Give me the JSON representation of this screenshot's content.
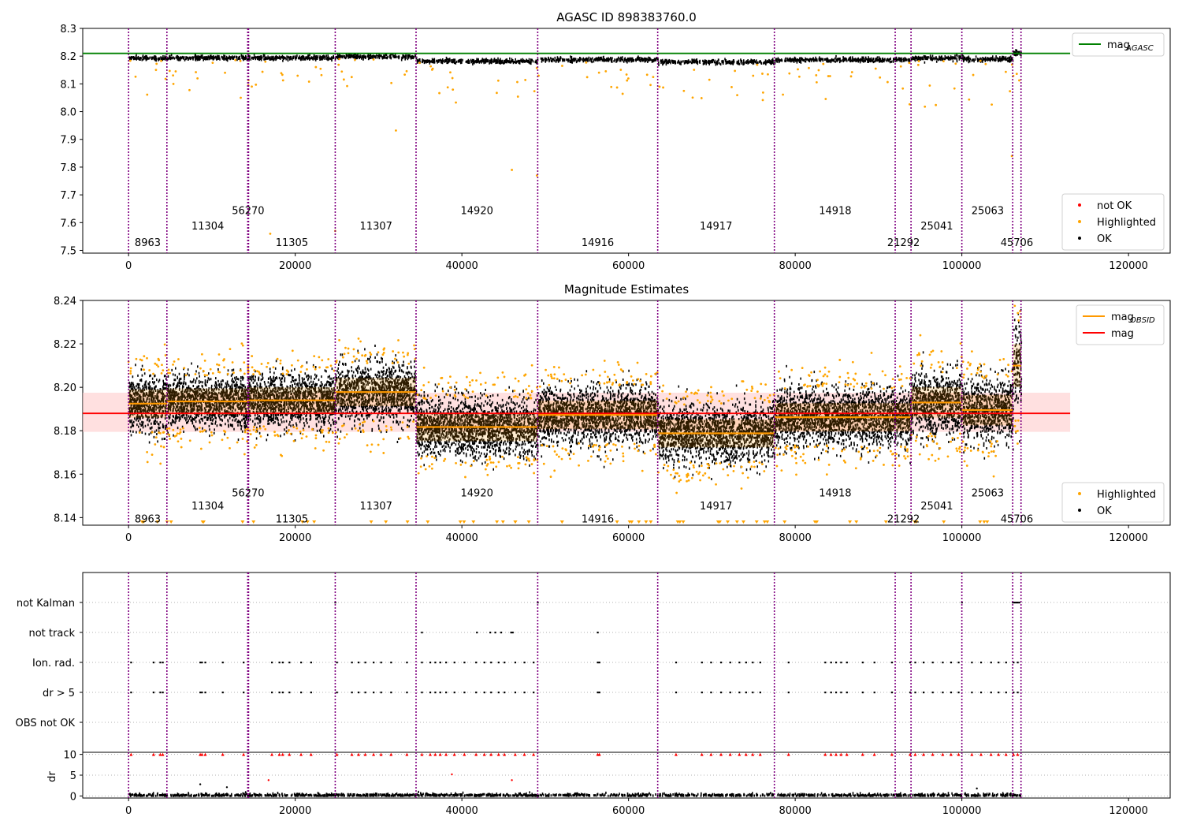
{
  "colors": {
    "ok": "#000000",
    "not_ok": "#ff0000",
    "highlighted": "#ffa500",
    "mag_agasc": "#008000",
    "mag": "#ff0000",
    "mag_band": "#ffcccc",
    "obsid_line": "#800080",
    "obsid_mag": "#ff9900",
    "grid": "#b0b0b0"
  },
  "chart_data": [
    {
      "type": "scatter",
      "title": "AGASC ID 898383760.0",
      "xlim": [
        -5500,
        125000
      ],
      "ylim": [
        7.49,
        8.3
      ],
      "xticks": [
        0,
        20000,
        40000,
        60000,
        80000,
        100000,
        120000
      ],
      "xtick_labels": [
        "0",
        "20000",
        "40000",
        "60000",
        "80000",
        "100000",
        "120000"
      ],
      "yticks": [
        7.5,
        7.6,
        7.7,
        7.8,
        7.9,
        8.0,
        8.1,
        8.2,
        8.3
      ],
      "ytick_labels": [
        "7.5",
        "7.6",
        "7.7",
        "7.8",
        "7.9",
        "8.0",
        "8.1",
        "8.2",
        "8.3"
      ],
      "mag_agasc": 8.21,
      "mag_agasc_x": [
        -5500,
        113000
      ],
      "legend_upper": {
        "position": "upper right",
        "entries": [
          {
            "label": "mag",
            "sub": "AGASC",
            "color": "#008000"
          }
        ]
      },
      "legend_lower": {
        "position": "lower right",
        "entries": [
          {
            "label": "not OK",
            "color": "#ff0000"
          },
          {
            "label": "Highlighted",
            "color": "#ffa500"
          },
          {
            "label": "OK",
            "color": "#000000"
          }
        ]
      },
      "obsid_boundaries": [
        0,
        4600,
        14300,
        14400,
        24800,
        34500,
        49100,
        63500,
        77500,
        92000,
        93900,
        100000,
        106100,
        107100
      ],
      "obsid_labels": [
        {
          "text": "8963",
          "x": 2300,
          "row": 0
        },
        {
          "text": "11304",
          "x": 9500,
          "row": 1
        },
        {
          "text": "56270",
          "x": 14350,
          "row": 2
        },
        {
          "text": "11305",
          "x": 19600,
          "row": 0
        },
        {
          "text": "11307",
          "x": 29700,
          "row": 1
        },
        {
          "text": "14920",
          "x": 41800,
          "row": 2
        },
        {
          "text": "14916",
          "x": 56300,
          "row": 0
        },
        {
          "text": "14917",
          "x": 70500,
          "row": 1
        },
        {
          "text": "14918",
          "x": 84800,
          "row": 2
        },
        {
          "text": "21292",
          "x": 93000,
          "row": 0
        },
        {
          "text": "25041",
          "x": 97000,
          "row": 1
        },
        {
          "text": "25063",
          "x": 103100,
          "row": 2
        },
        {
          "text": "45706",
          "x": 106600,
          "row": 0
        }
      ],
      "label_rows_y": [
        7.53,
        7.59,
        7.645
      ]
    },
    {
      "type": "scatter",
      "title": "Magnitude Estimates",
      "xlim": [
        -5500,
        125000
      ],
      "ylim": [
        8.1365,
        8.24
      ],
      "xticks": [
        0,
        20000,
        40000,
        60000,
        80000,
        100000,
        120000
      ],
      "xtick_labels": [
        "0",
        "20000",
        "40000",
        "60000",
        "80000",
        "100000",
        "120000"
      ],
      "yticks": [
        8.14,
        8.16,
        8.18,
        8.2,
        8.22,
        8.24
      ],
      "ytick_labels": [
        "8.14",
        "8.16",
        "8.18",
        "8.20",
        "8.22",
        "8.24"
      ],
      "mag": 8.188,
      "mag_band": [
        8.1795,
        8.1975
      ],
      "mag_x": [
        -5500,
        113000
      ],
      "obsid_segments": [
        {
          "x0": 0,
          "x1": 4600,
          "mean": 8.1925,
          "std": 0.0065
        },
        {
          "x0": 4600,
          "x1": 14300,
          "mean": 8.1935,
          "std": 0.006
        },
        {
          "x0": 14300,
          "x1": 14400,
          "mean": 8.194,
          "std": 0.006
        },
        {
          "x0": 14400,
          "x1": 24800,
          "mean": 8.194,
          "std": 0.006
        },
        {
          "x0": 24800,
          "x1": 34500,
          "mean": 8.1978,
          "std": 0.0065
        },
        {
          "x0": 34500,
          "x1": 49100,
          "mean": 8.1817,
          "std": 0.0065
        },
        {
          "x0": 49100,
          "x1": 63500,
          "mean": 8.1873,
          "std": 0.0065
        },
        {
          "x0": 63500,
          "x1": 77500,
          "mean": 8.1788,
          "std": 0.0065
        },
        {
          "x0": 77500,
          "x1": 92000,
          "mean": 8.1862,
          "std": 0.0065
        },
        {
          "x0": 92000,
          "x1": 93900,
          "mean": 8.1862,
          "std": 0.0065
        },
        {
          "x0": 93900,
          "x1": 100000,
          "mean": 8.193,
          "std": 0.007
        },
        {
          "x0": 100000,
          "x1": 106100,
          "mean": 8.1895,
          "std": 0.007
        },
        {
          "x0": 106100,
          "x1": 107100,
          "mean": 8.21,
          "std": 0.01
        }
      ],
      "legend_upper": {
        "position": "upper right",
        "entries": [
          {
            "label": "mag",
            "sub": "OBSID",
            "color": "#ff9900"
          },
          {
            "label": "mag",
            "sub": "",
            "color": "#ff0000"
          }
        ]
      },
      "legend_lower": {
        "position": "lower right",
        "entries": [
          {
            "label": "Highlighted",
            "color": "#ffa500"
          },
          {
            "label": "OK",
            "color": "#000000"
          }
        ]
      },
      "obsid_boundaries": [
        0,
        4600,
        14300,
        14400,
        24800,
        34500,
        49100,
        63500,
        77500,
        92000,
        93900,
        100000,
        106100,
        107100
      ],
      "label_rows_y": [
        8.1395,
        8.1455,
        8.1515
      ]
    },
    {
      "type": "scatter",
      "title": "",
      "xlim": [
        -5500,
        125000
      ],
      "categories": [
        "not Kalman",
        "not track",
        "Ion. rad.",
        "dr > 5",
        "OBS not OK"
      ],
      "flags": {
        "not Kalman": [
          24800,
          49100,
          100000,
          106100,
          106300,
          106500,
          106700,
          106900
        ],
        "not track": [
          35200,
          41800,
          43400,
          44000,
          44700,
          45900,
          46100,
          56300
        ],
        "Ion. rad.": [
          300,
          3000,
          3800,
          4100,
          8600,
          8800,
          9200,
          11300,
          13800,
          17200,
          18100,
          18500,
          19300,
          20700,
          21900,
          25000,
          26800,
          27600,
          28400,
          29400,
          30300,
          31500,
          33400,
          35200,
          36200,
          36800,
          37400,
          38100,
          39100,
          40300,
          41700,
          42700,
          43500,
          44400,
          45100,
          46400,
          47500,
          48600,
          56300,
          56500,
          65700,
          68800,
          69900,
          71100,
          72200,
          73300,
          74100,
          74900,
          75800,
          79200,
          83600,
          84300,
          84900,
          85500,
          86200,
          88100,
          89500,
          91600,
          93800,
          94400,
          95400,
          96500,
          97700,
          98700,
          99600,
          101200,
          102300,
          103500,
          104400,
          105300,
          106200,
          106700
        ],
        "dr > 5": [
          300,
          3000,
          3800,
          4100,
          8600,
          8800,
          9200,
          11300,
          13800,
          17200,
          18100,
          18500,
          19300,
          20700,
          21900,
          25000,
          26800,
          27600,
          28400,
          29400,
          30300,
          31500,
          33400,
          35200,
          36200,
          36800,
          37400,
          38100,
          39100,
          40300,
          41700,
          42700,
          43500,
          44400,
          45100,
          46400,
          47500,
          48600,
          56300,
          56500,
          65700,
          68800,
          69900,
          71100,
          72200,
          73300,
          74100,
          74900,
          75800,
          79200,
          83600,
          84300,
          84900,
          85500,
          86200,
          88100,
          89500,
          91600,
          93800,
          94400,
          95400,
          96500,
          97700,
          98700,
          99600,
          101200,
          102300,
          103500,
          104400,
          105300,
          106200,
          106700
        ],
        "OBS not OK": []
      },
      "obsid_boundaries": [
        0,
        4600,
        14300,
        14400,
        24800,
        34500,
        49100,
        63500,
        77500,
        92000,
        93900,
        100000,
        106100,
        107100
      ]
    },
    {
      "type": "scatter",
      "title": "",
      "ylabel": "dr",
      "xlim": [
        -5500,
        125000
      ],
      "ylim": [
        -0.5,
        10.5
      ],
      "xticks": [
        0,
        20000,
        40000,
        60000,
        80000,
        100000,
        120000
      ],
      "xtick_labels": [
        "0",
        "20000",
        "40000",
        "60000",
        "80000",
        "100000",
        "120000"
      ],
      "yticks": [
        0,
        5,
        10
      ],
      "ytick_labels": [
        "0",
        "5",
        "10"
      ],
      "clipped_dr_x": [
        300,
        3000,
        3800,
        4100,
        8600,
        8800,
        9200,
        11300,
        13800,
        17200,
        18100,
        18500,
        19300,
        20700,
        21900,
        25000,
        26800,
        27600,
        28400,
        29400,
        30300,
        31500,
        33400,
        35200,
        36200,
        36800,
        37400,
        38100,
        39100,
        40300,
        41700,
        42700,
        43500,
        44400,
        45100,
        46400,
        47500,
        48600,
        56300,
        56500,
        65700,
        68800,
        69900,
        71100,
        72200,
        73300,
        74100,
        74900,
        75800,
        79200,
        83600,
        84300,
        84900,
        85500,
        86200,
        88100,
        89500,
        91600,
        93800,
        94400,
        95400,
        96500,
        97700,
        98700,
        99600,
        101200,
        102300,
        103500,
        104400,
        105300,
        106200,
        106700
      ],
      "obsid_boundaries": [
        0,
        4600,
        14300,
        14400,
        24800,
        34500,
        49100,
        63500,
        77500,
        92000,
        93900,
        100000,
        106100,
        107100
      ]
    }
  ]
}
